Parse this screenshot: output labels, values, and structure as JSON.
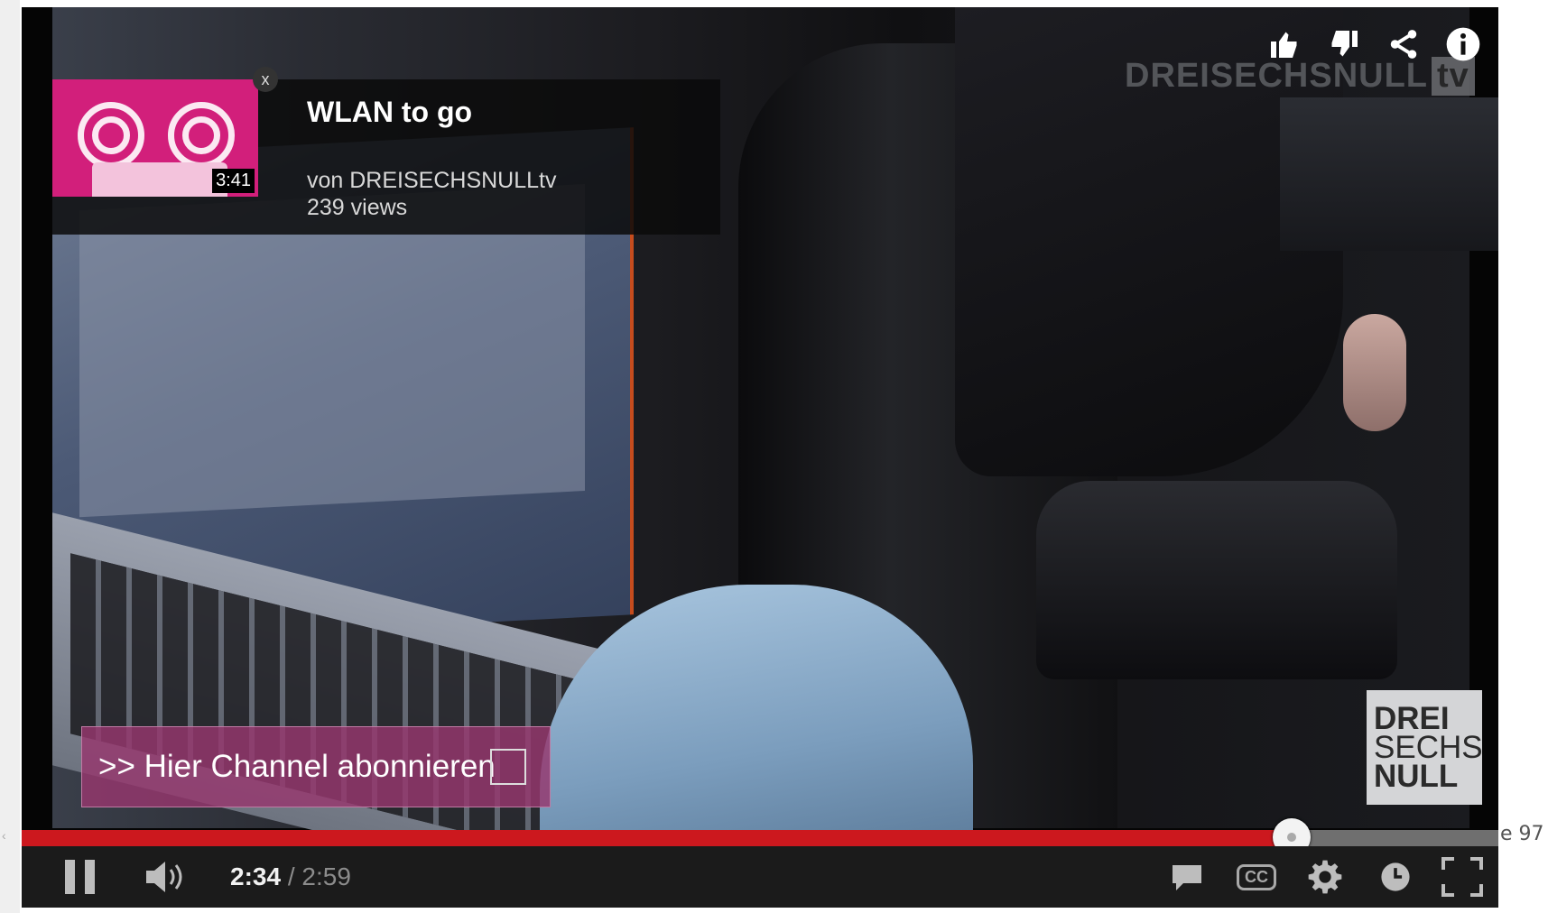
{
  "card": {
    "title": "WLAN to go",
    "duration": "3:41",
    "channel": "von DREISECHSNULLtv",
    "views": "239 views",
    "close_icon": "x"
  },
  "watermark": {
    "text": "DREISECHSNULL",
    "tv": "tv"
  },
  "channel_logo": {
    "line1": "DREI",
    "line2": "SECHS",
    "line3": "NULL"
  },
  "annotation": {
    "label": ">> Hier Channel abonnieren"
  },
  "top_actions": [
    "like-icon",
    "dislike-icon",
    "share-icon",
    "info-icon"
  ],
  "controls": {
    "current_time": "2:34",
    "separator": " / ",
    "duration": "2:59",
    "cc_label": "CC",
    "progress_fraction": 0.86,
    "accent_color": "#cc181e"
  },
  "page_fragment": "e 97"
}
